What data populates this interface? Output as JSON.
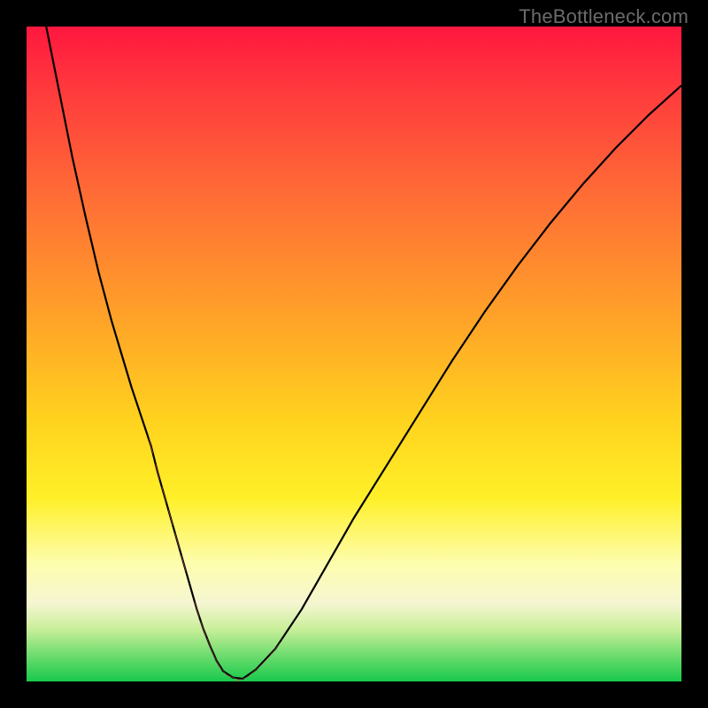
{
  "watermark": "TheBottleneck.com",
  "colors": {
    "background_black": "#000000",
    "gradient_top": "#ff173f",
    "gradient_bottom": "#18c94c",
    "curve": "#000000",
    "marker": "#e06a70"
  },
  "chart_data": {
    "type": "line",
    "title": "",
    "xlabel": "",
    "ylabel": "",
    "xlim": [
      0,
      100
    ],
    "ylim": [
      0,
      100
    ],
    "x": [
      3,
      5,
      7,
      9,
      11,
      13,
      14.5,
      16,
      17.5,
      19,
      20,
      21,
      22,
      23,
      24,
      25,
      26,
      27,
      28,
      29,
      30,
      31.5,
      33,
      35,
      38,
      42,
      46,
      50,
      55,
      60,
      65,
      70,
      75,
      80,
      85,
      90,
      95,
      100
    ],
    "values": [
      100,
      90,
      80,
      71,
      62.5,
      55,
      50,
      45,
      40.5,
      36,
      32,
      28.5,
      25,
      21.5,
      18,
      14.5,
      11,
      8,
      5.5,
      3.2,
      1.6,
      0.6,
      0.4,
      1.8,
      5,
      11,
      18,
      25,
      33,
      41,
      49,
      56.5,
      63.5,
      70,
      76,
      81.5,
      86.5,
      91
    ],
    "markers": {
      "x": [
        19,
        20,
        21,
        22,
        23,
        24,
        26,
        27,
        28,
        29,
        30,
        31.5,
        33,
        35,
        36.5,
        38
      ],
      "y": [
        36,
        32,
        28.5,
        25,
        21.5,
        18,
        11,
        8,
        5.5,
        3.2,
        1.6,
        0.6,
        0.4,
        1.8,
        3.2,
        5
      ]
    },
    "grid": false,
    "legend": false
  }
}
